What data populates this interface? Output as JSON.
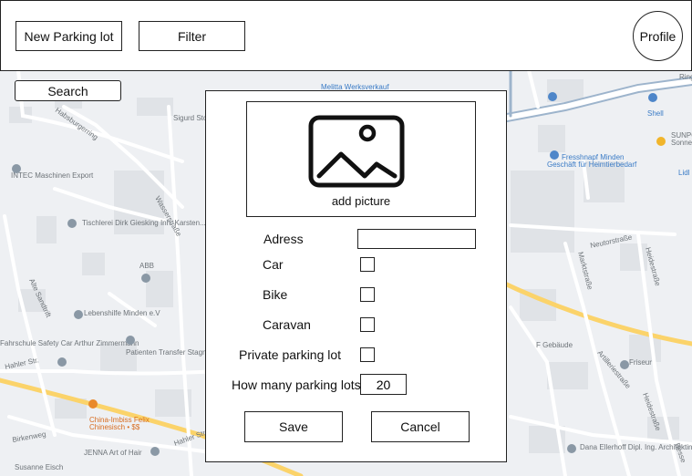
{
  "header": {
    "new_parking_lot_label": "New Parking lot",
    "filter_label": "Filter",
    "profile_label": "Profile"
  },
  "search": {
    "label": "Search"
  },
  "map": {
    "labels": [
      "Melitta Werksverkauf",
      "Habsburgerring",
      "Sigurd Stolte Kraftfahrzeuge",
      "INTEC Maschinen Export",
      "Tischlerei Dirk Giesking Inh. Karsten...",
      "ABB",
      "Alte Sandtrift",
      "Lebenshilfe Minden e.V",
      "Patienten Transfer Stagneth",
      "Fahrschule Safety Car Arthur Zimmermann",
      "Hahler Str.",
      "China-Imbiss Felix",
      "Chinesisch • $$",
      "Birkenweg",
      "JENNA Art of Hair",
      "Susanne Eisch",
      "Hahler Str.",
      "Fresshnapf Minden",
      "Geschäft für Heimtierbedarf",
      "Shell",
      "SUNPO",
      "Sonnenst",
      "Lidl",
      "Neutorstraße",
      "Marktstraße",
      "Heidestraße",
      "Artilleriestraße",
      "Friseur",
      "F Gebäude",
      "Dana Ellerhoff Dipl. Ing. Architektin",
      "Heidestraße",
      "Besse",
      "Ring",
      "Wasserstraße"
    ]
  },
  "dialog": {
    "add_picture_label": "add picture",
    "fields": {
      "adress_label": "Adress",
      "adress_value": "",
      "car_label": "Car",
      "bike_label": "Bike",
      "caravan_label": "Caravan",
      "private_label": "Private parking lot",
      "count_label": "How many parking lots",
      "count_value": "20"
    },
    "save_label": "Save",
    "cancel_label": "Cancel"
  }
}
